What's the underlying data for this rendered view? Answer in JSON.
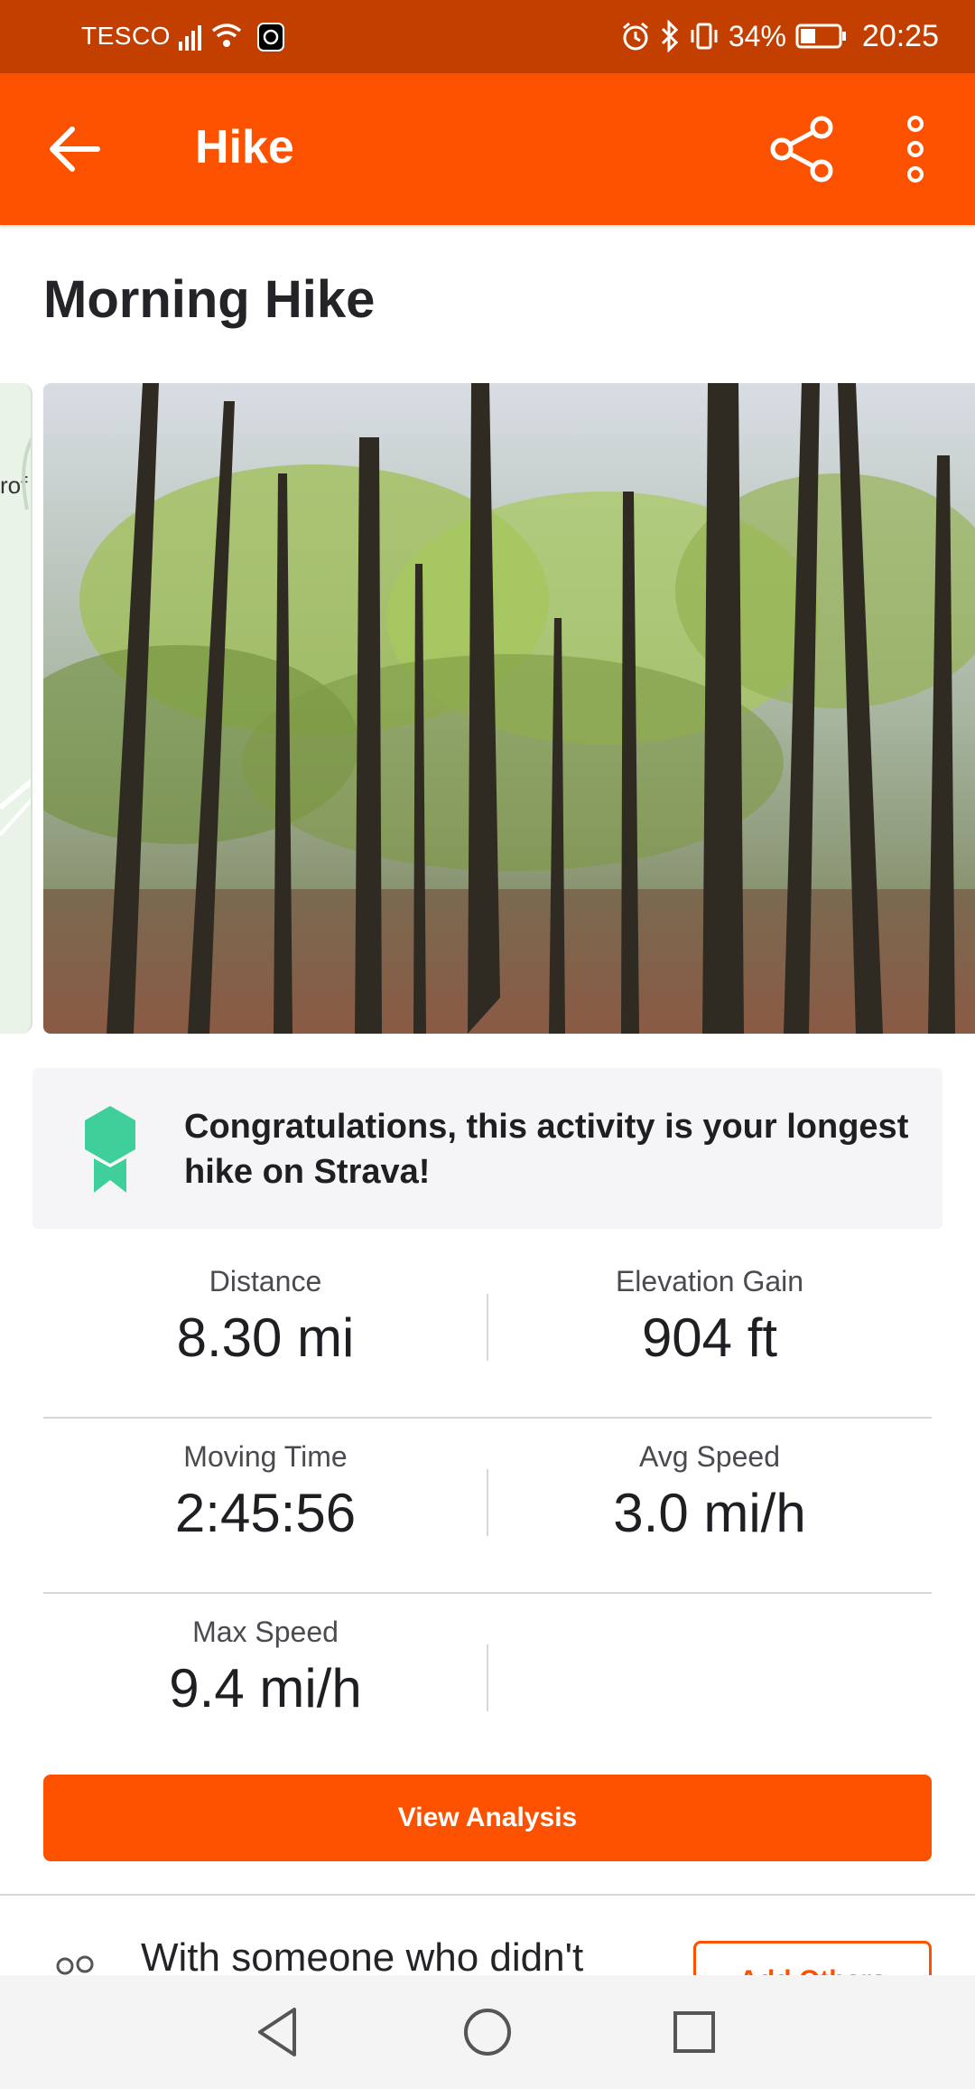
{
  "status_bar": {
    "carrier": "TESCO",
    "battery": "34%",
    "time": "20:25"
  },
  "app_bar": {
    "title": "Hike",
    "back_icon": "arrow-left-icon",
    "share_icon": "share-icon",
    "more_icon": "more-vertical-icon"
  },
  "activity": {
    "title": "Morning Hike"
  },
  "media": {
    "map_peek_text": "rof"
  },
  "achievement": {
    "message": "Congratulations, this activity is your longest hike on Strava!",
    "icon": "award-ribbon-icon",
    "color": "#3ecf9a"
  },
  "stats": [
    {
      "label": "Distance",
      "value": "8.30 mi"
    },
    {
      "label": "Elevation Gain",
      "value": "904 ft"
    },
    {
      "label": "Moving Time",
      "value": "2:45:56"
    },
    {
      "label": "Avg Speed",
      "value": "3.0 mi/h"
    },
    {
      "label": "Max Speed",
      "value": "9.4 mi/h"
    }
  ],
  "buttons": {
    "view_analysis": "View Analysis",
    "add_others": "Add Others"
  },
  "with_others": {
    "text": "With someone who didn't"
  },
  "colors": {
    "brand": "#fc5200",
    "status_bar": "#c33f00"
  }
}
